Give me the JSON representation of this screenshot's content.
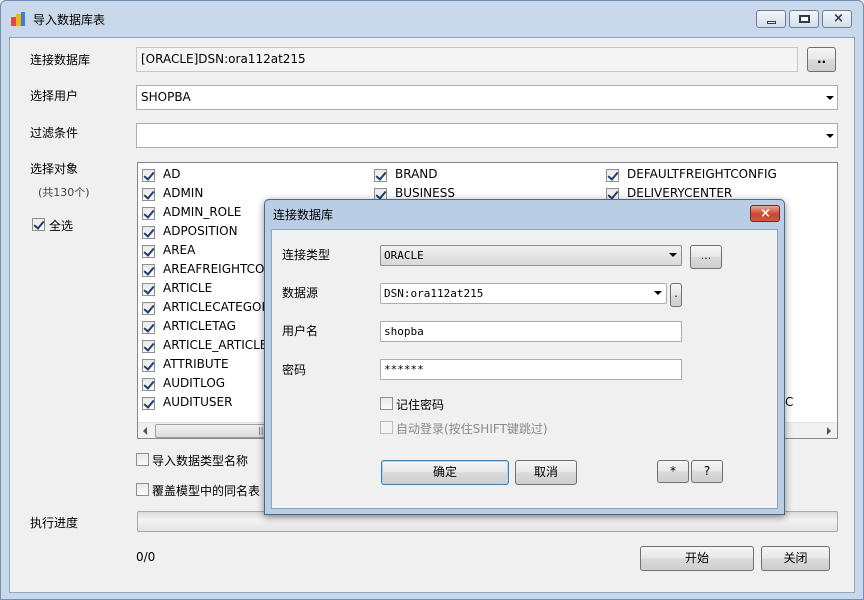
{
  "window": {
    "title": "导入数据库表"
  },
  "form": {
    "connect_db_label": "连接数据库",
    "connect_db_value": "[ORACLE]DSN:ora112at215",
    "browse_label": "..",
    "user_label": "选择用户",
    "user_value": "SHOPBA",
    "filter_label": "过滤条件",
    "filter_value": "",
    "objects_label": "选择对象",
    "objects_count": "(共130个)",
    "select_all_label": "全选",
    "select_all_checked": true
  },
  "objects": {
    "col1": [
      "AD",
      "ADMIN",
      "ADMIN_ROLE",
      "ADPOSITION",
      "AREA",
      "AREAFREIGHTCONFIG",
      "ARTICLE",
      "ARTICLECATEGORY",
      "ARTICLETAG",
      "ARTICLE_ARTICLETAG",
      "ATTRIBUTE",
      "AUDITLOG",
      "AUDITUSER"
    ],
    "col2": [
      "BRAND",
      "BUSINESS"
    ],
    "col3": [
      "DEFAULTFREIGHTCONFIG",
      "DELIVERYCENTER"
    ],
    "col3_partial": "C",
    "scroll_grip": "|||"
  },
  "options": {
    "import_type_names": "导入数据类型名称",
    "overwrite_same_name": "覆盖模型中的同名表"
  },
  "progress": {
    "label": "执行进度",
    "counter": "0/0",
    "value": 0
  },
  "buttons": {
    "start": "开始",
    "close": "关闭"
  },
  "dialog": {
    "title": "连接数据库",
    "conn_type_label": "连接类型",
    "conn_type_value": "ORACLE",
    "conn_type_more": "...",
    "datasource_label": "数据源",
    "datasource_value": "DSN:ora112at215",
    "datasource_more": ".",
    "username_label": "用户名",
    "username_value": "shopba",
    "password_label": "密码",
    "password_value": "******",
    "remember_password": "记住密码",
    "remember_checked": false,
    "auto_login": "自动登录(按住SHIFT键跳过)",
    "auto_login_checked": false,
    "ok": "确定",
    "cancel": "取消",
    "star": "*",
    "help": "?"
  },
  "colors": {
    "frame": "#c9d8ea",
    "client": "#f0f0f0",
    "checkmark": "#1f3d6e",
    "close_red": "#c9462d"
  }
}
